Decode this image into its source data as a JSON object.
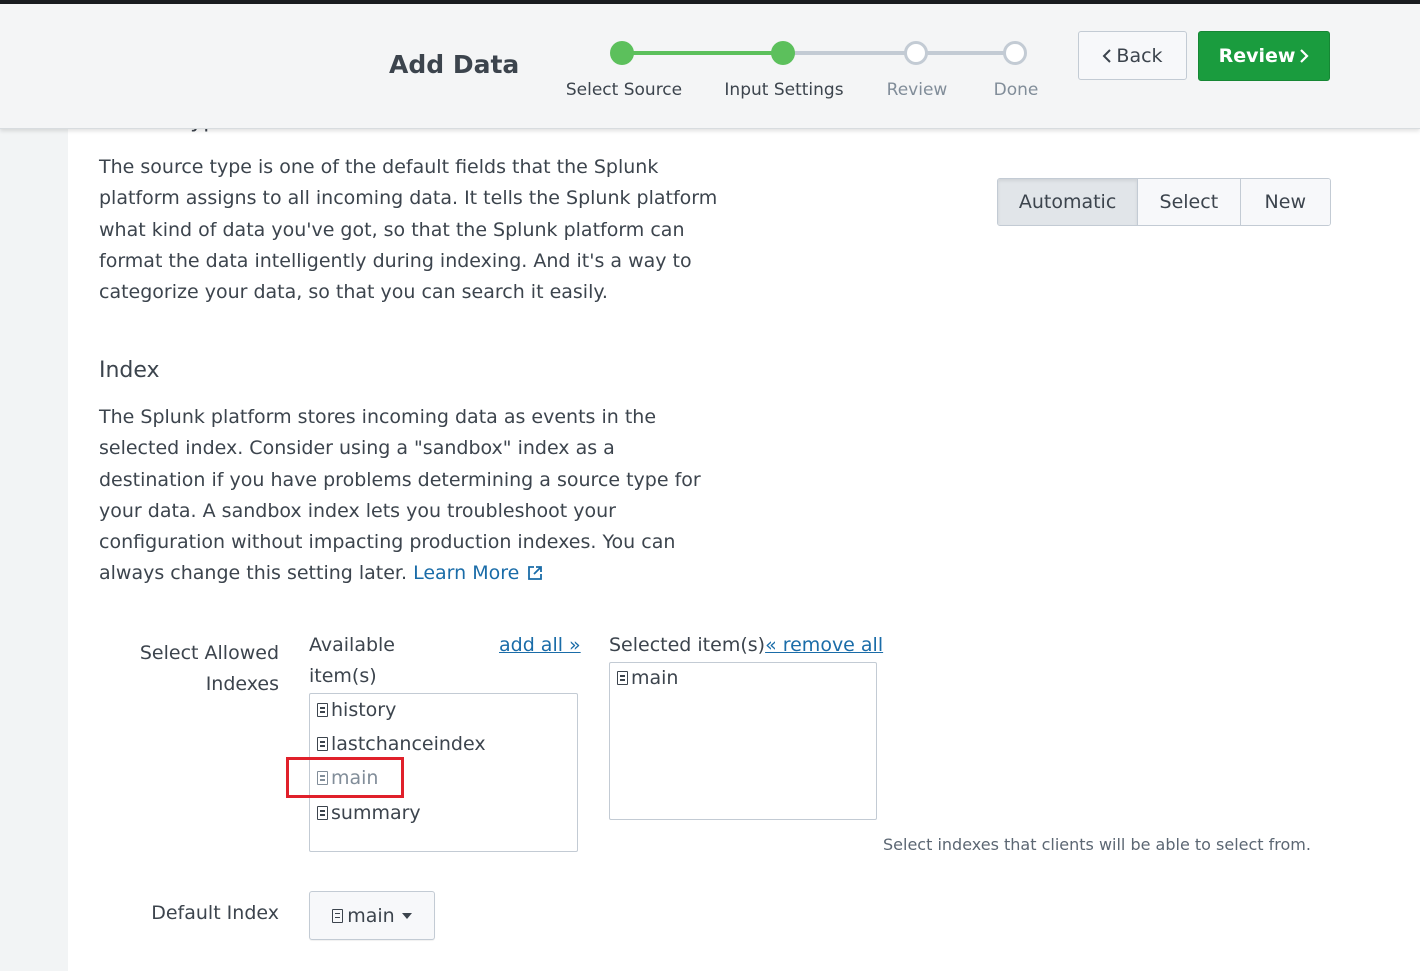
{
  "header": {
    "title": "Add Data",
    "steps": [
      {
        "label": "Select Source",
        "state": "done"
      },
      {
        "label": "Input Settings",
        "state": "current"
      },
      {
        "label": "Review",
        "state": "todo"
      },
      {
        "label": "Done",
        "state": "todo"
      }
    ],
    "back_label": "Back",
    "review_label": "Review"
  },
  "source_type": {
    "heading": "Source type",
    "description": "The source type is one of the default fields that the Splunk platform assigns to all incoming data. It tells the Splunk platform what kind of data you've got, so that the Splunk platform can format the data intelligently during indexing. And it's a way to categorize your data, so that you can search it easily.",
    "options": [
      "Automatic",
      "Select",
      "New"
    ],
    "selected": "Automatic"
  },
  "index": {
    "heading": "Index",
    "description": "The Splunk platform stores incoming data as events in the selected index. Consider using a \"sandbox\" index as a destination if you have problems determining a source type for your data. A sandbox index lets you troubleshoot your configuration without impacting production indexes. You can always change this setting later.",
    "learn_more": "Learn More",
    "allowed_label": "Select Allowed Indexes",
    "available_label": "Available item(s)",
    "add_all": "add all »",
    "available_items": [
      "history",
      "lastchanceindex",
      "main",
      "summary"
    ],
    "selected_label": "Selected item(s)",
    "remove_all": "« remove all",
    "selected_items": [
      "main"
    ],
    "help_text": "Select indexes that clients will be able to select from.",
    "default_label": "Default Index",
    "default_value": "main"
  },
  "colors": {
    "accent_green": "#5cc05c",
    "review_button": "#1a9c3e",
    "link": "#1a6ca8",
    "highlight_box": "#e0202a"
  }
}
